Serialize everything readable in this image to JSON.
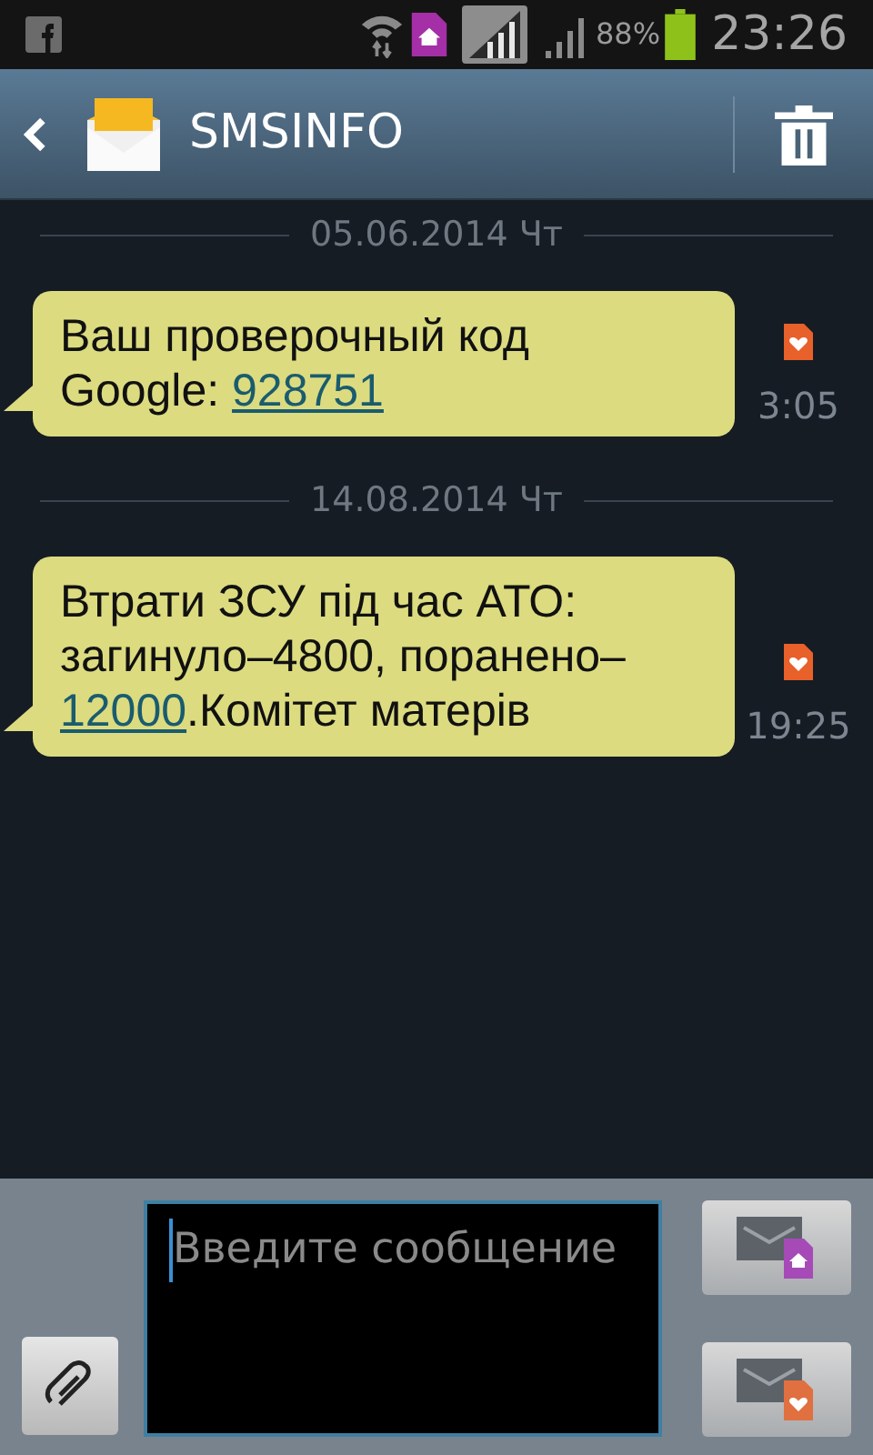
{
  "status_bar": {
    "battery_text": "88%",
    "time": "23:26"
  },
  "header": {
    "title": "SMSINFO"
  },
  "conversation": [
    {
      "date": "05.06.2014 Чт",
      "messages": [
        {
          "time": "3:05",
          "segments": [
            {
              "text": "Ваш проверочный код Google: ",
              "link": false
            },
            {
              "text": "928751",
              "link": true
            }
          ]
        }
      ]
    },
    {
      "date": "14.08.2014 Чт",
      "messages": [
        {
          "time": "19:25",
          "segments": [
            {
              "text": "Втрати ЗСУ під час АТО: загинуло–4800, поранено–",
              "link": false
            },
            {
              "text": "12000",
              "link": true
            },
            {
              "text": ".Комітет матерів",
              "link": false
            }
          ]
        }
      ]
    }
  ],
  "composer": {
    "placeholder": "Введите сообщение"
  }
}
